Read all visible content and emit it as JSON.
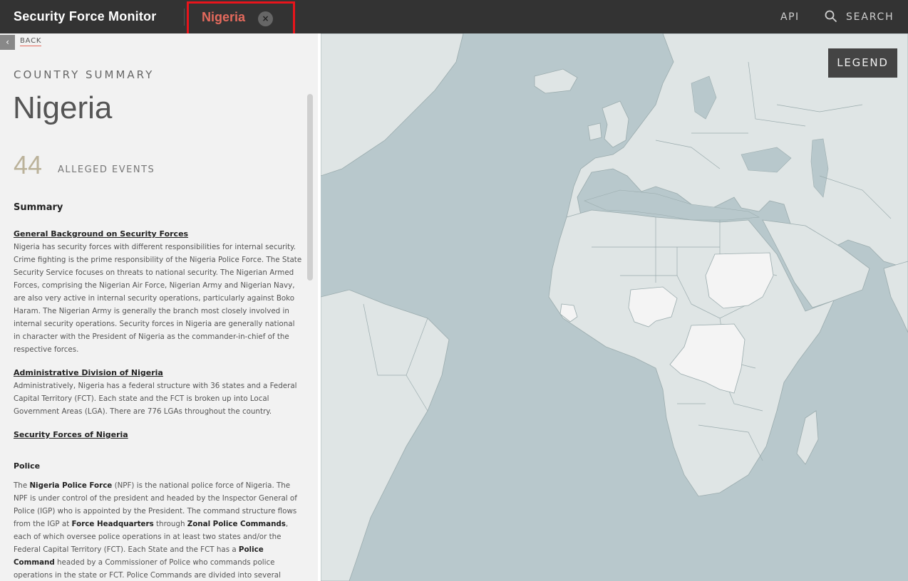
{
  "header": {
    "brand": "Security Force Monitor",
    "country_tab": "Nigeria",
    "close_glyph": "×",
    "api": "API",
    "search": "SEARCH"
  },
  "sidebar": {
    "back_glyph": "‹",
    "back": "BACK",
    "section_label": "COUNTRY SUMMARY",
    "country_name": "Nigeria",
    "events_count": "44",
    "events_label": "ALLEGED EVENTS",
    "summary_heading": "Summary",
    "sections": [
      {
        "heading": "General Background on Security Forces",
        "text": "Nigeria has security forces with different responsibilities for internal security. Crime fighting is the prime responsibility of the Nigeria Police Force. The State Security Service focuses on threats to national security. The Nigerian Armed Forces, comprising the Nigerian Air Force, Nigerian Army and Nigerian Navy, are also very active in internal security operations, particularly against Boko Haram. The Nigerian Army is generally the branch most closely involved in internal security operations. Security forces in Nigeria are generally national in character with the President of Nigeria as the commander-in-chief of the respective forces."
      },
      {
        "heading": "Administrative Division of Nigeria",
        "text": "Administratively, Nigeria has a federal structure with 36 states and a Federal Capital Territory (FCT). Each state and the FCT is broken up into Local Government Areas (LGA). There are 776 LGAs throughout the country."
      },
      {
        "heading": "Security Forces of Nigeria"
      }
    ],
    "police": {
      "heading": "Police",
      "t1": "The ",
      "b1": "Nigeria Police Force",
      "t2": " (NPF) is the national police force of Nigeria. The NPF is under control of the president and headed by the Inspector General of Police (IGP) who is appointed by the President. The command structure flows from the IGP at ",
      "b2": "Force Headquarters",
      "t3": " through ",
      "b3": "Zonal Police Commands",
      "t4": ", each of which oversee police operations in at least two states and/or the Federal Capital Territory (FCT). Each State and the FCT has a ",
      "b4": "Police Command",
      "t5": " headed by a Commissioner of Police who commands police operations in the state or FCT. Police Commands are divided into several"
    }
  },
  "map": {
    "legend": "LEGEND",
    "highlighted_countries": [
      "Nigeria",
      "Sudan",
      "Democratic Republic of the Congo",
      "Liberia"
    ],
    "colors": {
      "ocean": "#b8c8cc",
      "land": "#dfe5e5",
      "highlight": "#f4f4f4",
      "border": "#9aabad"
    }
  },
  "icons": {
    "search": "search-icon",
    "close": "close-icon",
    "back": "chevron-left-icon"
  }
}
